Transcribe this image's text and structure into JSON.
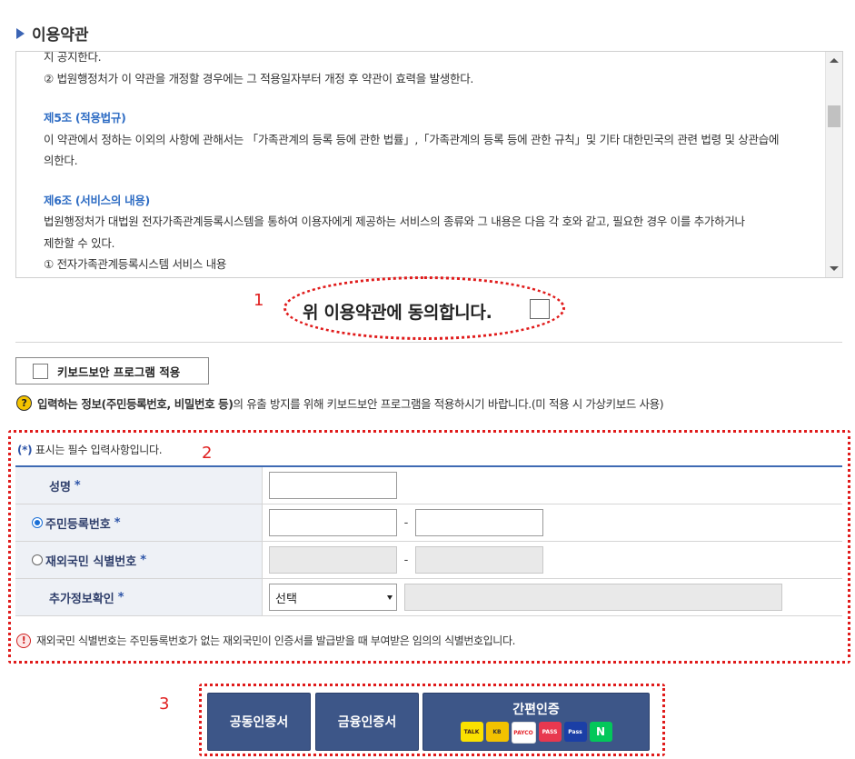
{
  "section_title": "이용약관",
  "terms": {
    "lines": [
      {
        "text": "지 공지한다.",
        "type": "text"
      },
      {
        "text": "② 법원행정처가 이 약관을 개정할 경우에는 그 적용일자부터 개정 후 약관이 효력을 발생한다.",
        "type": "text"
      },
      {
        "text": "",
        "type": "gap"
      },
      {
        "text": "제5조 (적용법규)",
        "type": "article"
      },
      {
        "text": "이 약관에서 정하는 이외의 사항에 관해서는 「가족관계의 등록 등에 관한 법률」,「가족관계의 등록 등에 관한 규칙」및 기타 대한민국의 관련 법령 및 상관습에",
        "type": "text"
      },
      {
        "text": "의한다.",
        "type": "text"
      },
      {
        "text": "",
        "type": "gap"
      },
      {
        "text": "제6조 (서비스의 내용)",
        "type": "article"
      },
      {
        "text": "법원행정처가 대법원 전자가족관계등록시스템을 통하여 이용자에게 제공하는 서비스의 종류와 그 내용은 다음 각 호와 같고, 필요한 경우 이를 추가하거나",
        "type": "text"
      },
      {
        "text": "제한할 수 있다.",
        "type": "text"
      },
      {
        "text": "① 전자가족관계등록시스템 서비스 내용",
        "type": "text"
      }
    ]
  },
  "annotations": {
    "n1": "1",
    "n2": "2",
    "n3": "3"
  },
  "agree_label": "위 이용약관에 동의합니다.",
  "keyboard_button_label": "키보드보안 프로그램 적용",
  "help": {
    "bold": "입력하는 정보(주민등록번호, 비밀번호 등)",
    "rest": "의 유출 방지를 위해 키보드보안 프로그램을 적용하시기 바랍니다.(미 적용 시 가상키보드 사용)"
  },
  "required_note": {
    "star": "(*)",
    "text": " 표시는 필수 입력사항입니다."
  },
  "form": {
    "name_label": "성명",
    "rrn_label": "주민등록번호",
    "foreign_label": "재외국민 식별번호",
    "extra_label": "추가정보확인",
    "star": "*",
    "select_value": "선택",
    "selected_option": "rrn"
  },
  "warning_text": "재외국민 식별번호는 주민등록번호가 없는 재외국민이 인증서를 발급받을 때 부여받은 임의의 식별번호입니다.",
  "buttons": {
    "joint_cert": "공동인증서",
    "finance_cert": "금융인증서",
    "easy_auth": "간편인증",
    "easy_icons": [
      {
        "name": "kakao",
        "label": "TALK",
        "bg": "#fae100",
        "fg": "#3a1d1d"
      },
      {
        "name": "kb",
        "label": "KB",
        "bg": "#f2c200",
        "fg": "#333"
      },
      {
        "name": "payco",
        "label": "PAYCO",
        "bg": "#ffffff",
        "fg": "#e4252c"
      },
      {
        "name": "pass",
        "label": "PASS",
        "bg": "#e8384f",
        "fg": "#ffffff"
      },
      {
        "name": "samsung-pass",
        "label": "Pass",
        "bg": "#1b3fa6",
        "fg": "#ffffff"
      },
      {
        "name": "naver",
        "label": "N",
        "bg": "#03c75a",
        "fg": "#ffffff"
      }
    ]
  }
}
